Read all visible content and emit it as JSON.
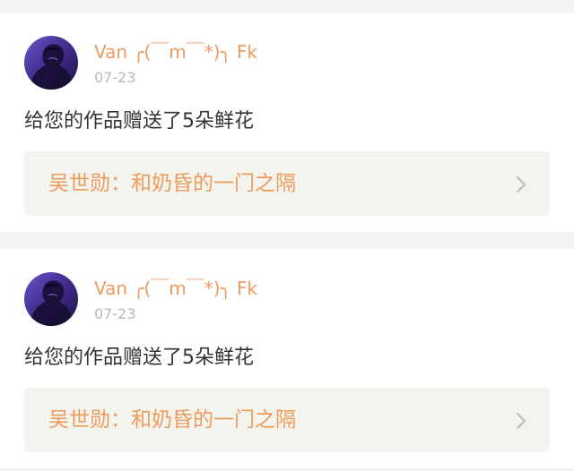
{
  "colors": {
    "page_background": "#f3f3f3",
    "card_background": "#ffffff",
    "accent": "#ee9a5f",
    "muted_text": "#b8b8b8",
    "body_text": "#333333",
    "link_box_background": "#f4f4ee"
  },
  "notifications": [
    {
      "avatar_icon": "user-avatar",
      "username": "Van ╭(￣m￣*)╮ Fk",
      "date": "07-23",
      "message": "给您的作品赠送了5朵鲜花",
      "work_title": "吴世勋：和奶昏的一门之隔",
      "chevron_icon": "chevron-right-icon"
    },
    {
      "avatar_icon": "user-avatar",
      "username": "Van ╭(￣m￣*)╮ Fk",
      "date": "07-23",
      "message": "给您的作品赠送了5朵鲜花",
      "work_title": "吴世勋：和奶昏的一门之隔",
      "chevron_icon": "chevron-right-icon"
    }
  ]
}
